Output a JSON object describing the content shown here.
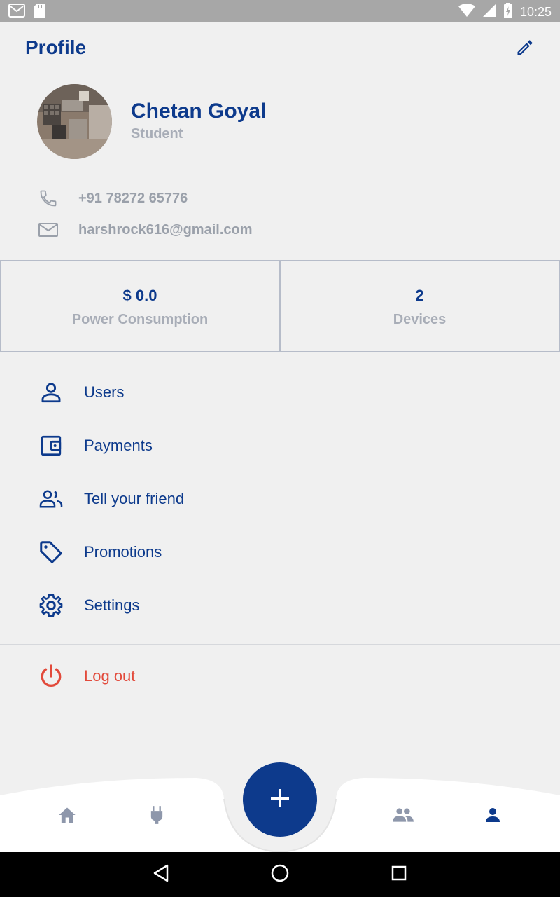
{
  "status_bar": {
    "time": "10:25"
  },
  "header": {
    "title": "Profile"
  },
  "profile": {
    "name": "Chetan Goyal",
    "role": "Student",
    "phone": "+91 78272 65776",
    "email": "harshrock616@gmail.com"
  },
  "stats": [
    {
      "value": "$ 0.0",
      "label": "Power Consumption"
    },
    {
      "value": "2",
      "label": "Devices"
    }
  ],
  "menu": [
    {
      "label": "Users",
      "icon": "user-icon"
    },
    {
      "label": "Payments",
      "icon": "wallet-icon"
    },
    {
      "label": "Tell your friend",
      "icon": "people-icon"
    },
    {
      "label": "Promotions",
      "icon": "tag-icon"
    },
    {
      "label": "Settings",
      "icon": "gear-icon"
    }
  ],
  "logout": {
    "label": "Log out",
    "icon": "power-icon"
  },
  "bottom_nav": {
    "items": [
      "home-icon",
      "plug-icon",
      "add-icon",
      "group-icon",
      "person-icon"
    ],
    "active": "person-icon"
  },
  "colors": {
    "primary": "#0d3a8c",
    "muted": "#a8adb7",
    "danger": "#e24a3b",
    "background": "#f0f0f0",
    "nav_inactive": "#8e97ab"
  }
}
